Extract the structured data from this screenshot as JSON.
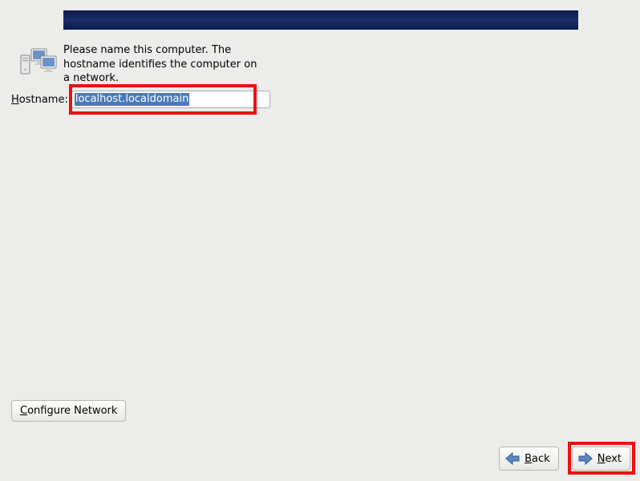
{
  "instruction": "Please name this computer.  The hostname identifies the computer on a network.",
  "hostname": {
    "label_pre": "H",
    "label_post": "ostname:",
    "value": "localhost.localdomain"
  },
  "buttons": {
    "configure_network_pre": "C",
    "configure_network_post": "onfigure Network",
    "back_pre": "",
    "back_underline": "B",
    "back_post": "ack",
    "next_pre": "",
    "next_underline": "N",
    "next_post": "ext"
  }
}
